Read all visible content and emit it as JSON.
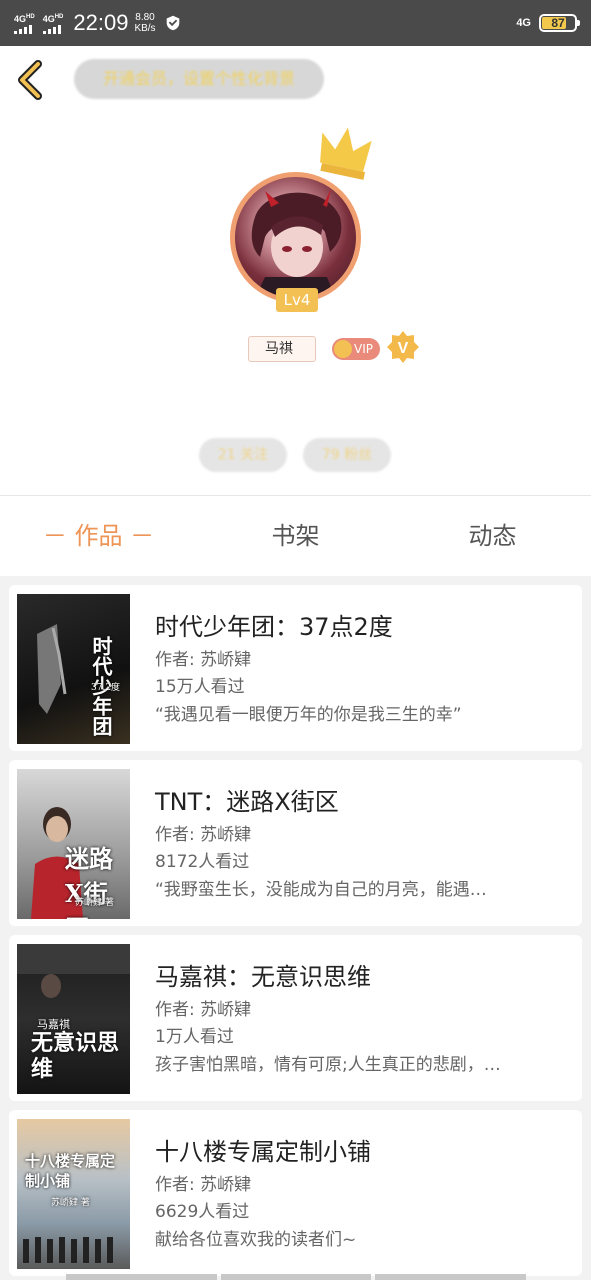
{
  "status_bar": {
    "signal1": "4G",
    "signal1_sup": "HD",
    "signal2": "4G",
    "signal2_sup": "HD",
    "time": "22:09",
    "speed_value": "8.80",
    "speed_unit": "KB/s",
    "network": "4G",
    "battery": "87"
  },
  "header": {
    "vip_banner": "开通会员，设置个性化背景"
  },
  "profile": {
    "level": "Lv4",
    "name": "马祺",
    "vip_label": "VIP",
    "v_badge": "V",
    "following": "21 关注",
    "fans": "79 粉丝"
  },
  "tabs": [
    {
      "label": "－ 作品 －"
    },
    {
      "label": "书架"
    },
    {
      "label": "动态"
    }
  ],
  "books": [
    {
      "title": "时代少年团：37点2度",
      "author": "作者: 苏峤肄",
      "views": "15万人看过",
      "desc": "“我遇见看一眼便万年的你是我三生的幸”",
      "cover_text": "时代少年团",
      "cover_sub": "37.2度"
    },
    {
      "title": "TNT：迷路X街区",
      "author": "作者: 苏峤肄",
      "views": "8172人看过",
      "desc": "“我野蛮生长，没能成为自己的月亮，能遇…",
      "cover_text": "迷路X街区",
      "cover_sub": "苏峤肄 著"
    },
    {
      "title": "马嘉祺：无意识思维",
      "author": "作者: 苏峤肄",
      "views": "1万人看过",
      "desc": "孩子害怕黑暗，情有可原;人生真正的悲剧，…",
      "cover_text": "无意识思维",
      "cover_sub": "马嘉祺"
    },
    {
      "title": "十八楼专属定制小铺",
      "author": "作者: 苏峤肄",
      "views": "6629人看过",
      "desc": "献给各位喜欢我的读者们~",
      "cover_text": "十八楼专属定制小铺",
      "cover_sub": "苏峤肄 著"
    }
  ],
  "colors": {
    "accent": "#ee9456",
    "level_badge": "#f3c053",
    "avatar_ring": "#f0a070",
    "status_bar": "#4a4a4a"
  }
}
